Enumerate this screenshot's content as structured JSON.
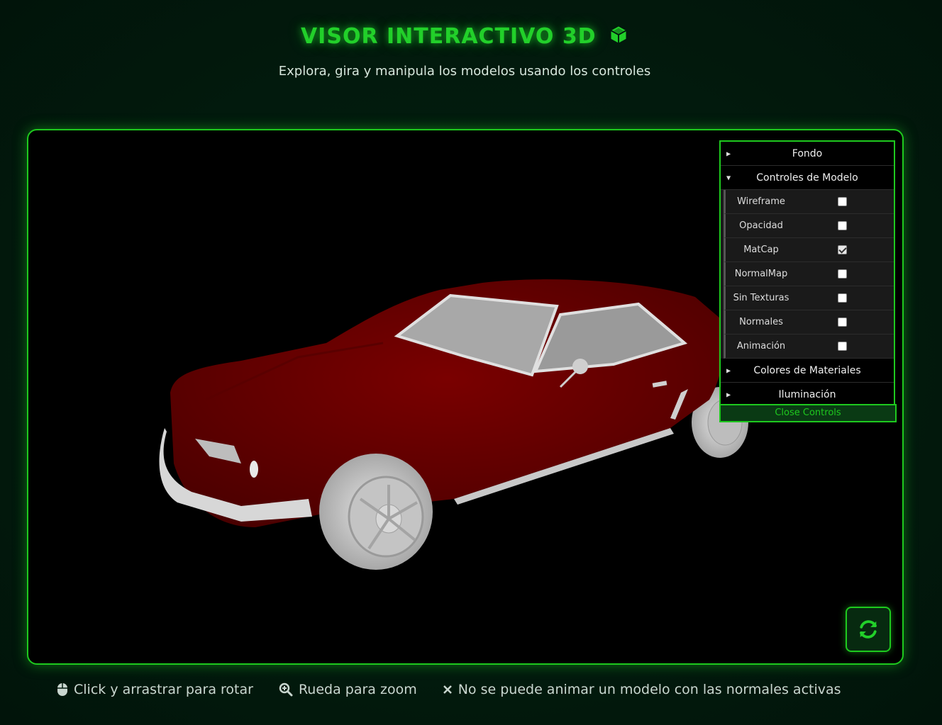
{
  "header": {
    "title": "VISOR INTERACTIVO 3D",
    "subtitle": "Explora, gira y manipula los modelos usando los controles",
    "title_icon": "cube-icon"
  },
  "colors": {
    "accent": "#1ec91e",
    "background": "#021a0d",
    "car_body": "#6b0000",
    "car_trim": "#cfcfcf"
  },
  "controls_panel": {
    "folders": [
      {
        "label": "Fondo",
        "open": false
      },
      {
        "label": "Controles de Modelo",
        "open": true
      },
      {
        "label": "Colores de Materiales",
        "open": false
      },
      {
        "label": "Iluminación",
        "open": false
      }
    ],
    "model_controls": [
      {
        "label": "Wireframe",
        "checked": false
      },
      {
        "label": "Opacidad",
        "checked": false
      },
      {
        "label": "MatCap",
        "checked": true
      },
      {
        "label": "NormalMap",
        "checked": false
      },
      {
        "label": "Sin Texturas",
        "checked": false
      },
      {
        "label": "Normales",
        "checked": false
      },
      {
        "label": "Animación",
        "checked": false
      }
    ],
    "close_label": "Close Controls"
  },
  "reset_button": {
    "icon": "refresh-icon"
  },
  "hints": [
    {
      "icon": "mouse-icon",
      "text": "Click y arrastrar para rotar"
    },
    {
      "icon": "zoom-icon",
      "text": "Rueda para zoom"
    },
    {
      "icon": "close-icon",
      "text": "No se puede animar un modelo con las normales activas"
    }
  ]
}
